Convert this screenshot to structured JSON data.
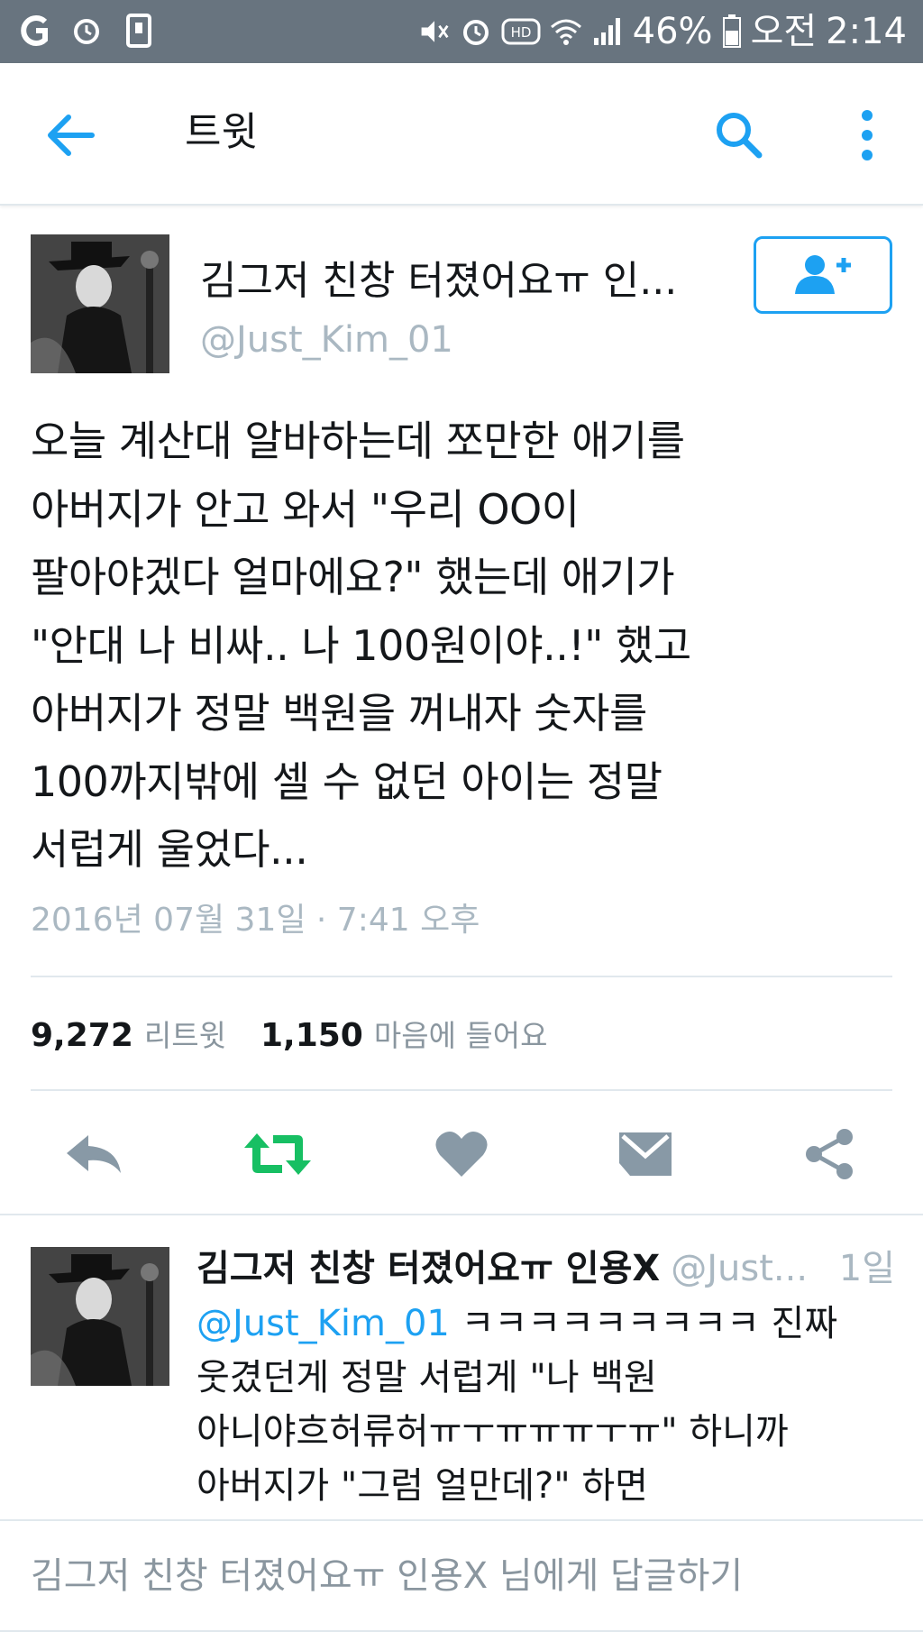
{
  "status_bar": {
    "battery": "46%",
    "period": "오전",
    "time": "2:14",
    "hd_badge": "HD",
    "icons": [
      "g-app-icon",
      "alarm-icon",
      "phone-icon",
      "mute-icon",
      "alarm-icon",
      "hd-voice-icon",
      "wifi-icon",
      "signal-icon",
      "battery-icon"
    ]
  },
  "app_bar": {
    "title": "트윗",
    "icons": [
      "back-arrow-icon",
      "search-icon",
      "more-vertical-icon"
    ]
  },
  "tweet": {
    "author_name": "김그저 친창 터졌어요ㅠ 인...",
    "author_handle": "@Just_Kim_01",
    "text": "오늘 계산대 알바하는데 쪼만한 애기를\n아버지가 안고 와서 \"우리 OO이\n팔아야겠다 얼마에요?\" 했는데 애기가\n\"안대 나 비싸.. 나 100원이야..!\" 했고\n아버지가 정말 백원을 꺼내자 숫자를\n100까지밖에 셀 수 없던 아이는 정말\n서럽게 울었다...",
    "timestamp": "2016년 07월 31일 · 7:41 오후",
    "retweet_count": "9,272",
    "retweet_label": "리트윗",
    "like_count": "1,150",
    "like_label": "마음에 들어요",
    "follow_icon": "add-user-icon",
    "accent_color": "#1da1f2",
    "retweet_color": "#17bf63"
  },
  "reply": {
    "name": "김그저 친창 터졌어요ㅠ 인용X",
    "handle": "@Just...",
    "time": "1일",
    "mention": "@Just_Kim_01",
    "text": " ㅋㅋㅋㅋㅋㅋㅋㅋㅋ 진짜\n웃겼던게 정말 서럽게 \"나 백원\n아니야흐허류허ㅠㅜㅠㅠㅠㅜㅠ\" 하니까\n아버지가 \"그럼 얼만데?\" 하면"
  },
  "reply_box": {
    "placeholder": "김그저 친창 터졌어요ㅠ 인용X 님에게 답글하기"
  }
}
